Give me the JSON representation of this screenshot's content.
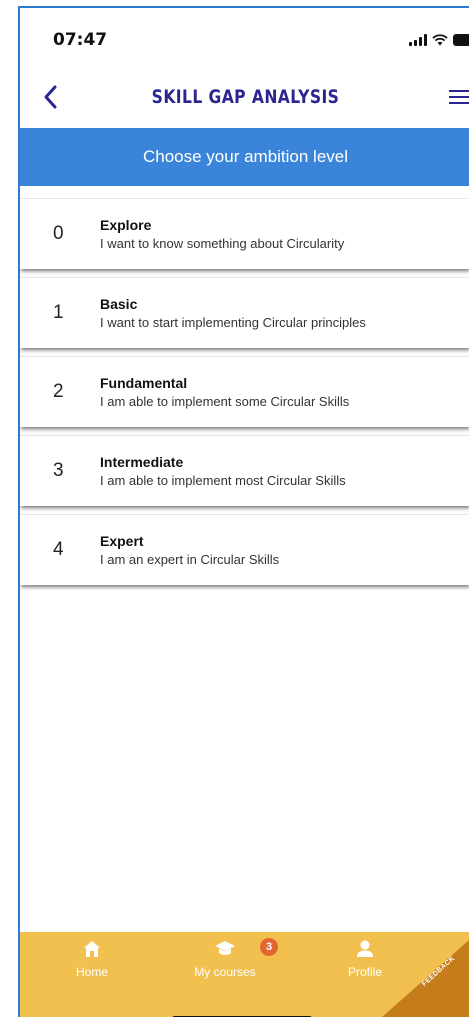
{
  "status_bar": {
    "time": "07:47",
    "signal_icon": "signal-icon",
    "wifi_icon": "wifi-icon",
    "battery_icon": "battery-icon"
  },
  "header": {
    "title": "SKILL GAP ANALYSIS",
    "back_icon": "chevron-left-icon",
    "menu_icon": "hamburger-menu-icon",
    "title_color": "#2b2591"
  },
  "banner": {
    "text": "Choose your ambition level",
    "color": "#3a85d9"
  },
  "levels": [
    {
      "number": "0",
      "name": "Explore",
      "description": "I want to know something about Circularity"
    },
    {
      "number": "1",
      "name": "Basic",
      "description": "I want to start implementing Circular principles"
    },
    {
      "number": "2",
      "name": "Fundamental",
      "description": "I am able to implement some Circular Skills"
    },
    {
      "number": "3",
      "name": "Intermediate",
      "description": "I am able to implement most Circular Skills"
    },
    {
      "number": "4",
      "name": "Expert",
      "description": "I am an expert in Circular Skills"
    }
  ],
  "tab_bar": {
    "color": "#f2c04f",
    "tabs": [
      {
        "label": "Home",
        "icon": "home-icon"
      },
      {
        "label": "My courses",
        "icon": "graduation-cap-icon",
        "badge": "3"
      },
      {
        "label": "Profile",
        "icon": "person-icon"
      }
    ]
  },
  "feedback": {
    "label": "FEEDBACK",
    "color": "#c47d1a"
  }
}
